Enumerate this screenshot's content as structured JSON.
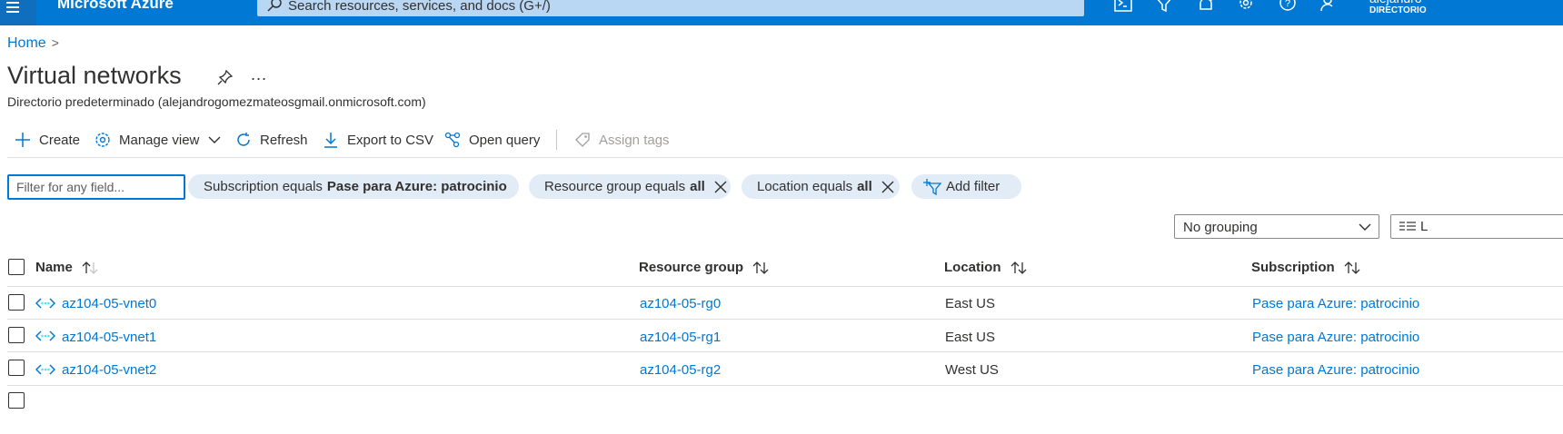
{
  "topbar": {
    "brand": "Microsoft Azure",
    "search_placeholder": "Search resources, services, and docs (G+/)",
    "icons": [
      "menu-icon",
      "cloud-shell-icon",
      "directory-filter-icon",
      "notifications-icon",
      "settings-icon",
      "help-icon",
      "feedback-icon"
    ],
    "user_name": "alejandro",
    "user_directory": "DIRECTORIO"
  },
  "breadcrumb": {
    "home": "Home",
    "separator": ">"
  },
  "page": {
    "title": "Virtual networks",
    "more": "...",
    "subtitle": "Directorio predeterminado (alejandrogomezmateosgmail.onmicrosoft.com)"
  },
  "toolbar": {
    "create": "Create",
    "manage_view": "Manage view",
    "refresh": "Refresh",
    "export_csv": "Export to CSV",
    "open_query": "Open query",
    "assign_tags": "Assign tags"
  },
  "filters": {
    "placeholder": "Filter for any field...",
    "subscription_label": "Subscription equals",
    "subscription_value": "Pase para Azure: patrocinio",
    "resource_group_label": "Resource group equals",
    "resource_group_value": "all",
    "location_label": "Location equals",
    "location_value": "all",
    "add_filter": "Add filter"
  },
  "grouping": {
    "selected": "No grouping",
    "view_label": "L"
  },
  "table": {
    "columns": [
      "Name",
      "Resource group",
      "Location",
      "Subscription"
    ],
    "rows": [
      {
        "name": "az104-05-vnet0",
        "resource_group": "az104-05-rg0",
        "location": "East US",
        "subscription": "Pase para Azure: patrocinio"
      },
      {
        "name": "az104-05-vnet1",
        "resource_group": "az104-05-rg1",
        "location": "East US",
        "subscription": "Pase para Azure: patrocinio"
      },
      {
        "name": "az104-05-vnet2",
        "resource_group": "az104-05-rg2",
        "location": "West US",
        "subscription": "Pase para Azure: patrocinio"
      }
    ]
  },
  "colors": {
    "accent": "#0078d4",
    "pill": "#e1ecf7",
    "text": "#323130"
  }
}
